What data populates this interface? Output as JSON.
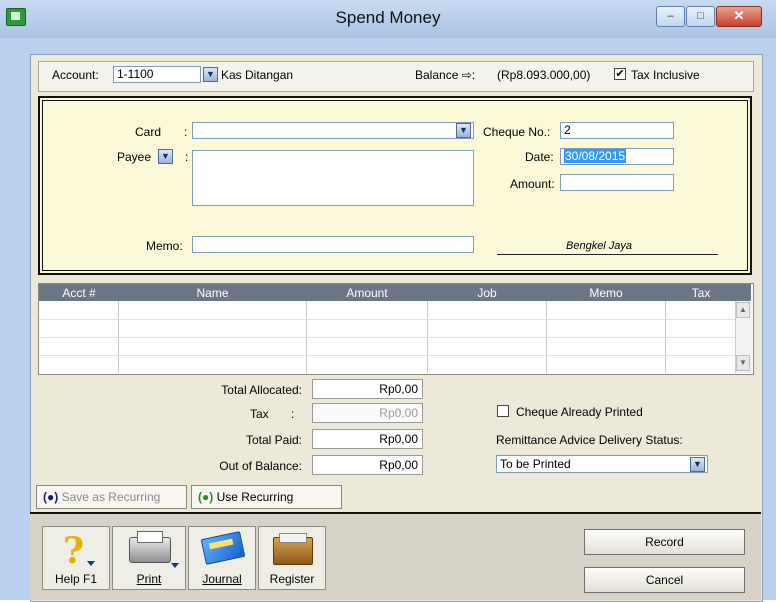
{
  "window": {
    "title": "Spend Money",
    "minimize_glyph": "–",
    "maximize_glyph": "□",
    "close_glyph": "✕"
  },
  "account": {
    "label": "Account:",
    "number": "1-1100",
    "name": "Kas Ditangan",
    "balance_label": "Balance ⇨:",
    "balance_value": "(Rp8.093.000,00)",
    "tax_inclusive_label": "Tax Inclusive",
    "tax_inclusive_checked": true
  },
  "cheque": {
    "card_label": "Card",
    "card_sep": ":",
    "card_value": "",
    "payee_label": "Payee",
    "payee_sep": ":",
    "payee_value": "",
    "memo_label": "Memo:",
    "memo_value": "",
    "cheque_no_label": "Cheque No.:",
    "cheque_no_value": "2",
    "date_label": "Date:",
    "date_value": "30/08/2015",
    "amount_label": "Amount:",
    "amount_value": "",
    "signature": "Bengkel Jaya"
  },
  "table": {
    "columns": [
      "Acct #",
      "Name",
      "Amount",
      "Job",
      "Memo",
      "Tax"
    ],
    "rows": []
  },
  "totals": {
    "total_allocated_label": "Total Allocated:",
    "total_allocated_value": "Rp0,00",
    "tax_label": "Tax",
    "tax_sep": ":",
    "tax_value": "Rp0,00",
    "total_paid_label": "Total Paid:",
    "total_paid_value": "Rp0,00",
    "out_of_balance_label": "Out of Balance:",
    "out_of_balance_value": "Rp0,00"
  },
  "options": {
    "cheque_printed_label": "Cheque Already Printed",
    "cheque_printed_checked": false,
    "remittance_label": "Remittance Advice Delivery Status:",
    "remittance_value": "To be Printed"
  },
  "recurring": {
    "save_label": "Save as Recurring",
    "use_label": "Use Recurring"
  },
  "toolbar": {
    "help_label": "Help F1",
    "print_label": "Print",
    "journal_label": "Journal",
    "register_label": "Register"
  },
  "actions": {
    "record_label": "Record",
    "cancel_label": "Cancel"
  },
  "colors": {
    "yellow_panel": "#fbf9d8",
    "grid_header": "#6b7786",
    "title_bar": "#b9d1ee",
    "close_red": "#c8412c"
  }
}
